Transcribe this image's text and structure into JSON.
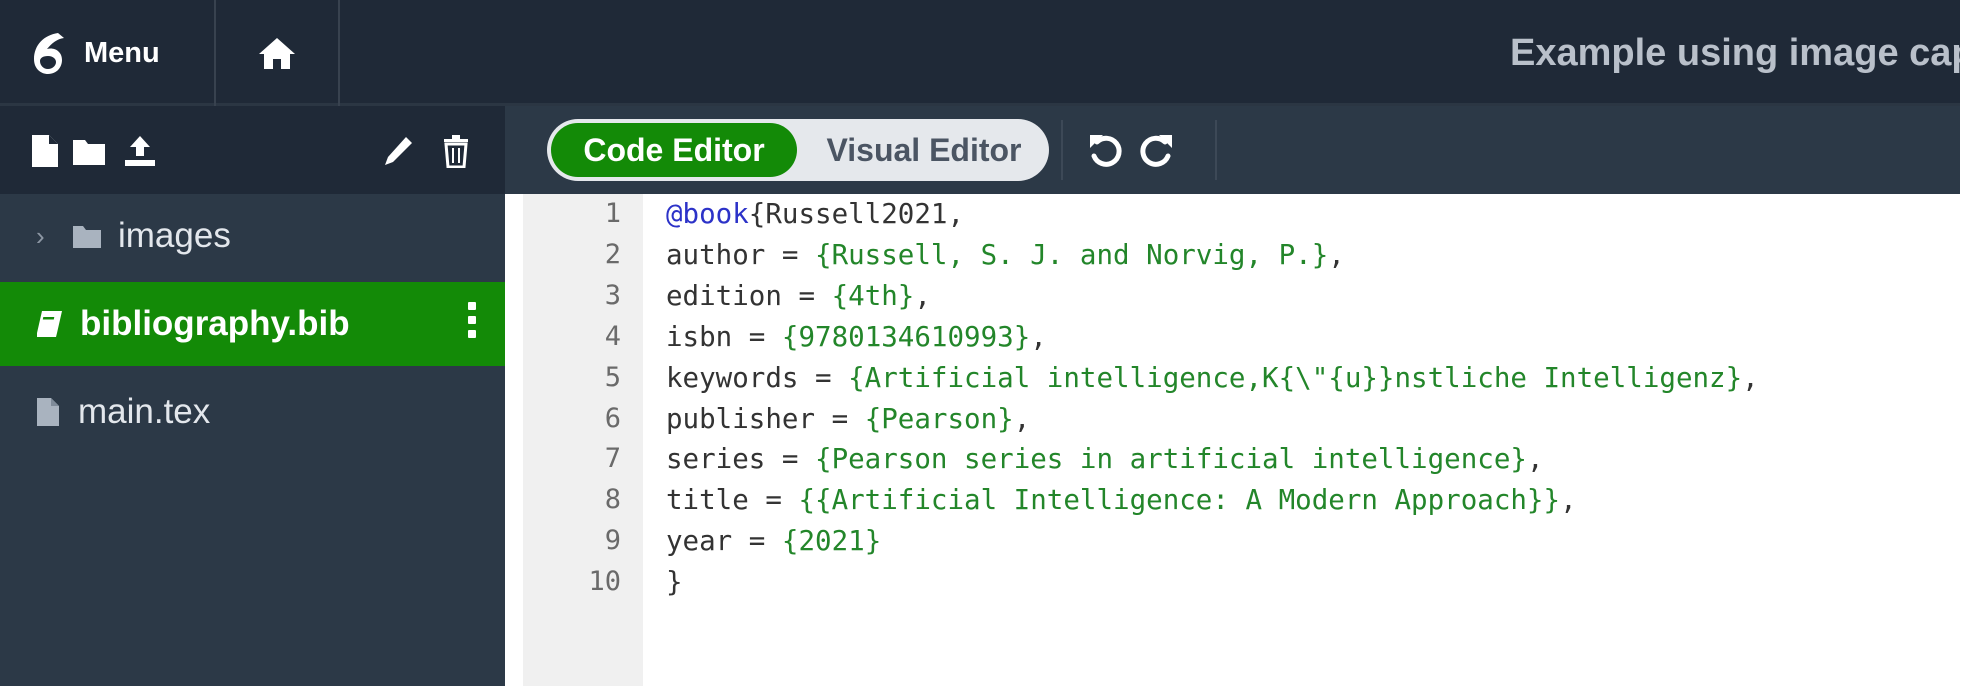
{
  "topbar": {
    "menu_label": "Menu",
    "project_title": "Example using image cap"
  },
  "sidebar": {
    "tree": [
      {
        "label": "images",
        "type": "folder",
        "icon": "folder-icon",
        "collapsed": true
      },
      {
        "label": "bibliography.bib",
        "type": "file",
        "icon": "book-icon",
        "selected": true
      },
      {
        "label": "main.tex",
        "type": "file",
        "icon": "file-icon"
      }
    ]
  },
  "editor": {
    "toggle": {
      "code_label": "Code Editor",
      "visual_label": "Visual Editor",
      "active": "Code Editor"
    },
    "lines": [
      {
        "no": "1",
        "key": "@book",
        "text": "{Russell2021,"
      },
      {
        "no": "2",
        "key": "author = ",
        "value": "{Russell, S. J. and Norvig, P.}",
        "end": ","
      },
      {
        "no": "3",
        "key": "edition = ",
        "value": "{4th}",
        "end": ","
      },
      {
        "no": "4",
        "key": "isbn = ",
        "value": "{9780134610993}",
        "end": ","
      },
      {
        "no": "5",
        "key": "keywords = ",
        "value": "{Artificial intelligence,K{\\\"{u}}nstliche Intelligenz}",
        "end": ","
      },
      {
        "no": "6",
        "key": "publisher = ",
        "value": "{Pearson}",
        "end": ","
      },
      {
        "no": "7",
        "key": "series = ",
        "value": "{Pearson series in artificial intelligence}",
        "end": ","
      },
      {
        "no": "8",
        "key": "title = ",
        "value": "{{Artificial Intelligence: A Modern Approach}}",
        "end": ","
      },
      {
        "no": "9",
        "key": "year = ",
        "value": "{2021}",
        "end": ""
      },
      {
        "no": "10",
        "key": "}",
        "value": "",
        "end": ""
      }
    ]
  },
  "colors": {
    "accent": "#138a07",
    "chrome_dark": "#1f2937",
    "sidebar_bg": "#2c3947",
    "code_string": "#23862a",
    "code_keyword": "#2c32c8"
  }
}
